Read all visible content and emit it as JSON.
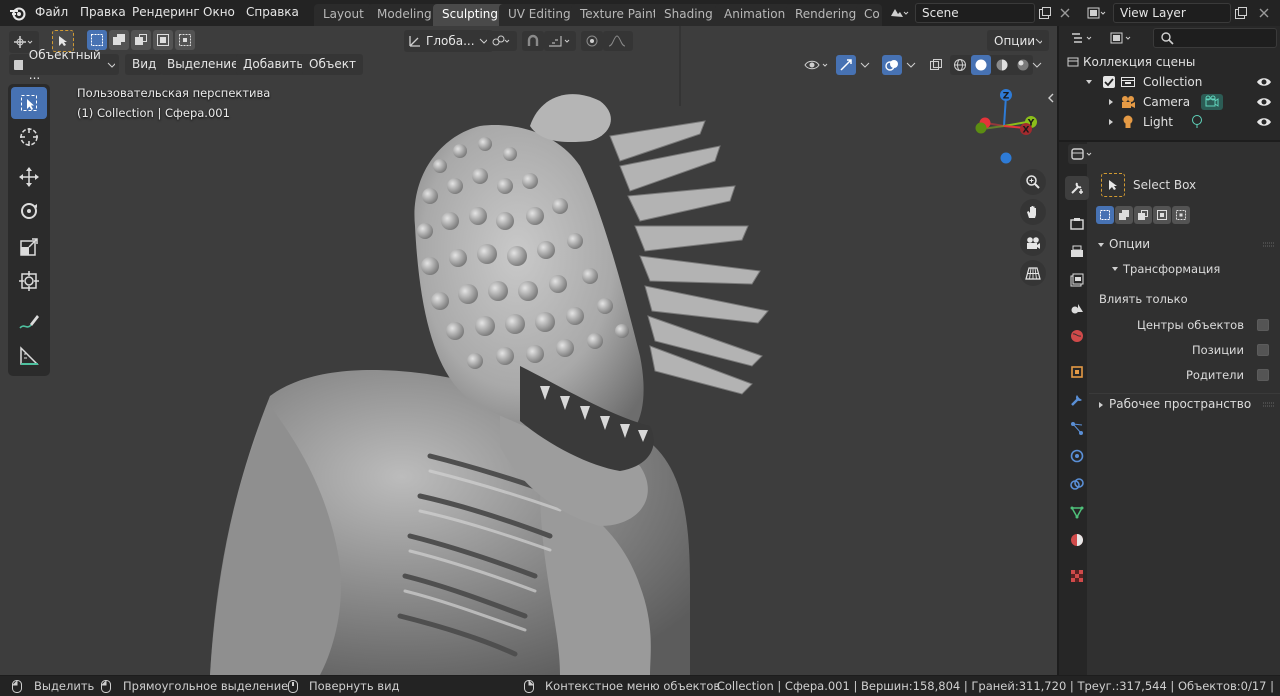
{
  "menus": [
    "Файл",
    "Правка",
    "Рендеринг",
    "Окно",
    "Справка"
  ],
  "workspaces": [
    "Layout",
    "Modeling",
    "Sculpting",
    "UV Editing",
    "Texture Paint",
    "Shading",
    "Animation",
    "Rendering",
    "Co"
  ],
  "active_workspace": "Sculpting",
  "scene": "Scene",
  "view_layer": "View Layer",
  "viewport": {
    "mode": "Объектный ...",
    "menu": [
      "Вид",
      "Выделение",
      "Добавить",
      "Объект"
    ],
    "orientation": "Глоба...",
    "options": "Опции",
    "overlay_line1": "Пользовательская перспектива",
    "overlay_line2": "(1) Collection | Сфера.001",
    "gizmo": {
      "z": "Z",
      "y": "Y",
      "x": "X"
    }
  },
  "outliner": {
    "title": "Коллекция сцены",
    "items": [
      "Collection",
      "Camera",
      "Light"
    ]
  },
  "properties": {
    "tool_name": "Select Box",
    "section_options": "Опции",
    "subsection_transform": "Трансформация",
    "affect_only": "Влиять только",
    "options": [
      "Центры объектов",
      "Позиции",
      "Родители"
    ],
    "workspace_section": "Рабочее пространство"
  },
  "status": {
    "select": "Выделить",
    "box_select": "Прямоугольное выделение",
    "rotate_view": "Повернуть вид",
    "context_menu": "Контекстное меню объектов",
    "stats": "Collection | Сфера.001 | Вершин:158,804 | Граней:311,720 | Треуг.:317,544 | Объектов:0/17 |"
  },
  "colors": {
    "accent": "#4772b3",
    "x_axis": "#e5343a",
    "y_axis": "#8bbf1a",
    "z_axis": "#2e7bd6"
  }
}
